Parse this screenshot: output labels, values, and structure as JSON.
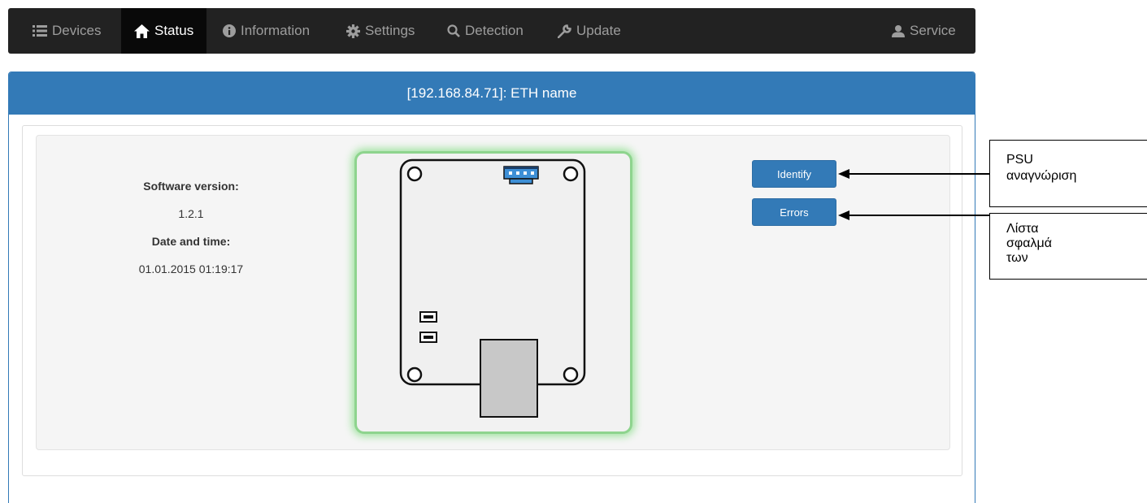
{
  "navbar": {
    "items": [
      {
        "label": "Devices",
        "icon": "list-icon"
      },
      {
        "label": "Status",
        "icon": "home-icon",
        "active": true
      },
      {
        "label": "Information",
        "icon": "info-circle-icon"
      },
      {
        "label": "Settings",
        "icon": "gear-icon"
      },
      {
        "label": "Detection",
        "icon": "search-icon"
      },
      {
        "label": "Update",
        "icon": "wrench-icon"
      }
    ],
    "service": {
      "label": "Service",
      "icon": "user-icon"
    }
  },
  "panel": {
    "title": "[192.168.84.71]: ETH name"
  },
  "device_info": {
    "software_version_label": "Software version:",
    "software_version": "1.2.1",
    "date_time_label": "Date and time:",
    "date_time": "01.01.2015 01:19:17"
  },
  "actions": {
    "identify_label": "Identify",
    "errors_label": "Errors"
  },
  "annotations": {
    "identify_line1": "PSU",
    "identify_line2": "αναγνώριση",
    "errors_line1": "Λίστα",
    "errors_line2": "σφαλμά",
    "errors_line3": "των"
  },
  "colors": {
    "navbar_bg": "#222222",
    "active_bg": "#090909",
    "primary": "#337ab7",
    "status_glow": "#8ed48e",
    "connector": "#3d8fd6"
  }
}
